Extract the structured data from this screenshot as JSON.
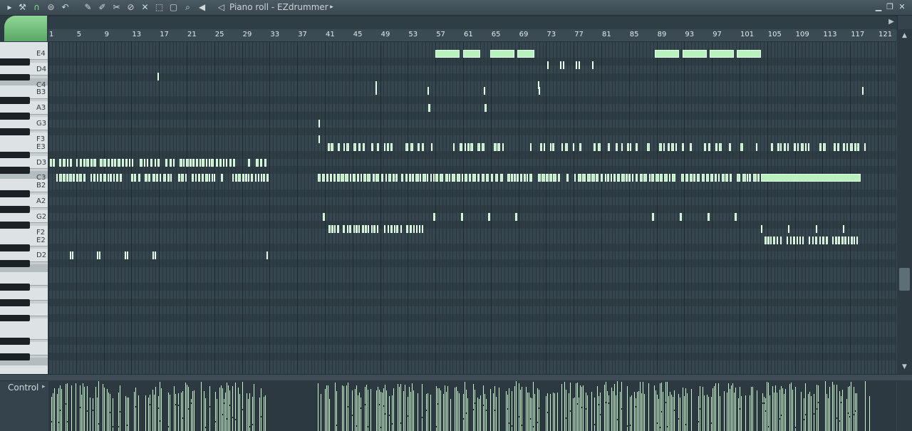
{
  "window": {
    "title": "Piano roll - EZdrummer",
    "minimize_icon": "minimize-icon",
    "maximize_icon": "restore-icon",
    "close_icon": "close-icon"
  },
  "toolbar": {
    "tools": [
      {
        "name": "menu-arrow-icon",
        "glyph": "▸"
      },
      {
        "name": "wrench-icon",
        "glyph": "⚒"
      },
      {
        "name": "magnet-icon",
        "glyph": "∩"
      },
      {
        "name": "options-icon",
        "glyph": "⊜"
      },
      {
        "name": "undo-icon",
        "glyph": "↶"
      },
      {
        "name": "pencil-icon",
        "glyph": "✎"
      },
      {
        "name": "paint-brush-icon",
        "glyph": "✐"
      },
      {
        "name": "delete-tool-icon",
        "glyph": "✂"
      },
      {
        "name": "mute-tool-icon",
        "glyph": "⊘"
      },
      {
        "name": "slice-tool-icon",
        "glyph": "✕"
      },
      {
        "name": "select-tool-icon",
        "glyph": "⬚"
      },
      {
        "name": "marquee-icon",
        "glyph": "▢"
      },
      {
        "name": "zoom-icon",
        "glyph": "⌕"
      },
      {
        "name": "playback-icon",
        "glyph": "◀"
      },
      {
        "name": "speaker-icon",
        "glyph": "◁"
      }
    ]
  },
  "ruler": {
    "bars": [
      "1",
      "5",
      "9",
      "13",
      "17",
      "21",
      "25",
      "29",
      "33",
      "37",
      "41",
      "45",
      "49",
      "53",
      "57",
      "61",
      "65",
      "69",
      "73",
      "77",
      "81",
      "85",
      "89",
      "93",
      "97",
      "101",
      "105",
      "109",
      "113",
      "117",
      "121"
    ]
  },
  "keyboard": {
    "labels": [
      "E4",
      "D4",
      "C4",
      "B3",
      "A3",
      "G3",
      "F3",
      "E3",
      "D3",
      "C3",
      "B2",
      "A2",
      "G2",
      "F2",
      "E2",
      "D2"
    ]
  },
  "control": {
    "label": "Control"
  }
}
